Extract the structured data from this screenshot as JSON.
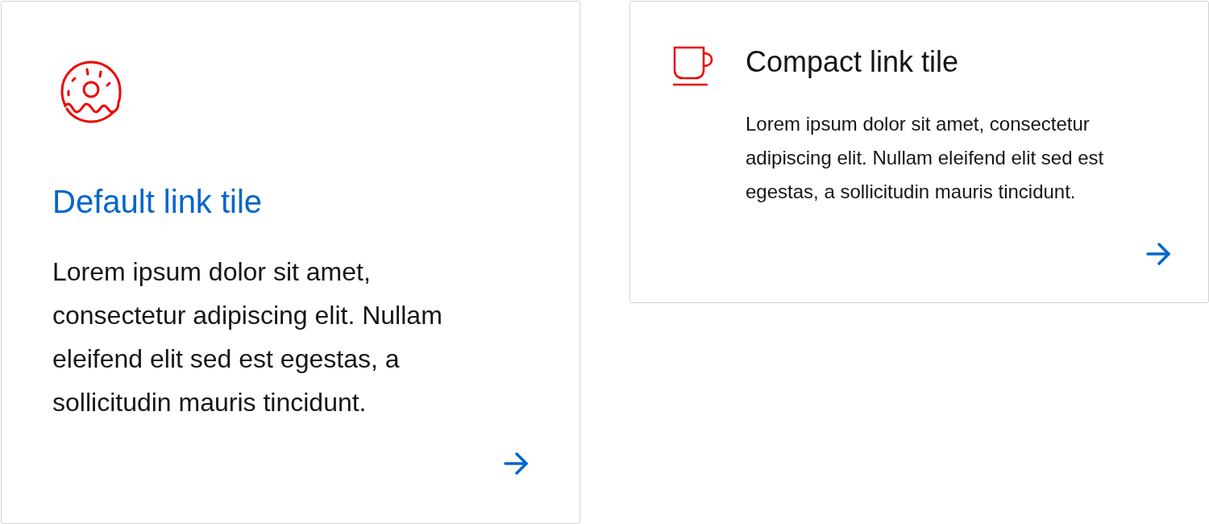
{
  "tiles": [
    {
      "kind": "default",
      "title": "Default link tile",
      "body": "Lorem ipsum dolor sit amet, consectetur adipiscing elit. Nullam eleifend elit sed est egestas, a sollicitudin mauris tincidunt."
    },
    {
      "kind": "compact",
      "title": "Compact link tile",
      "body": "Lorem ipsum dolor sit amet, consectetur adipiscing elit. Nullam eleifend elit sed est egestas, a sollicitudin mauris tincidunt."
    }
  ]
}
